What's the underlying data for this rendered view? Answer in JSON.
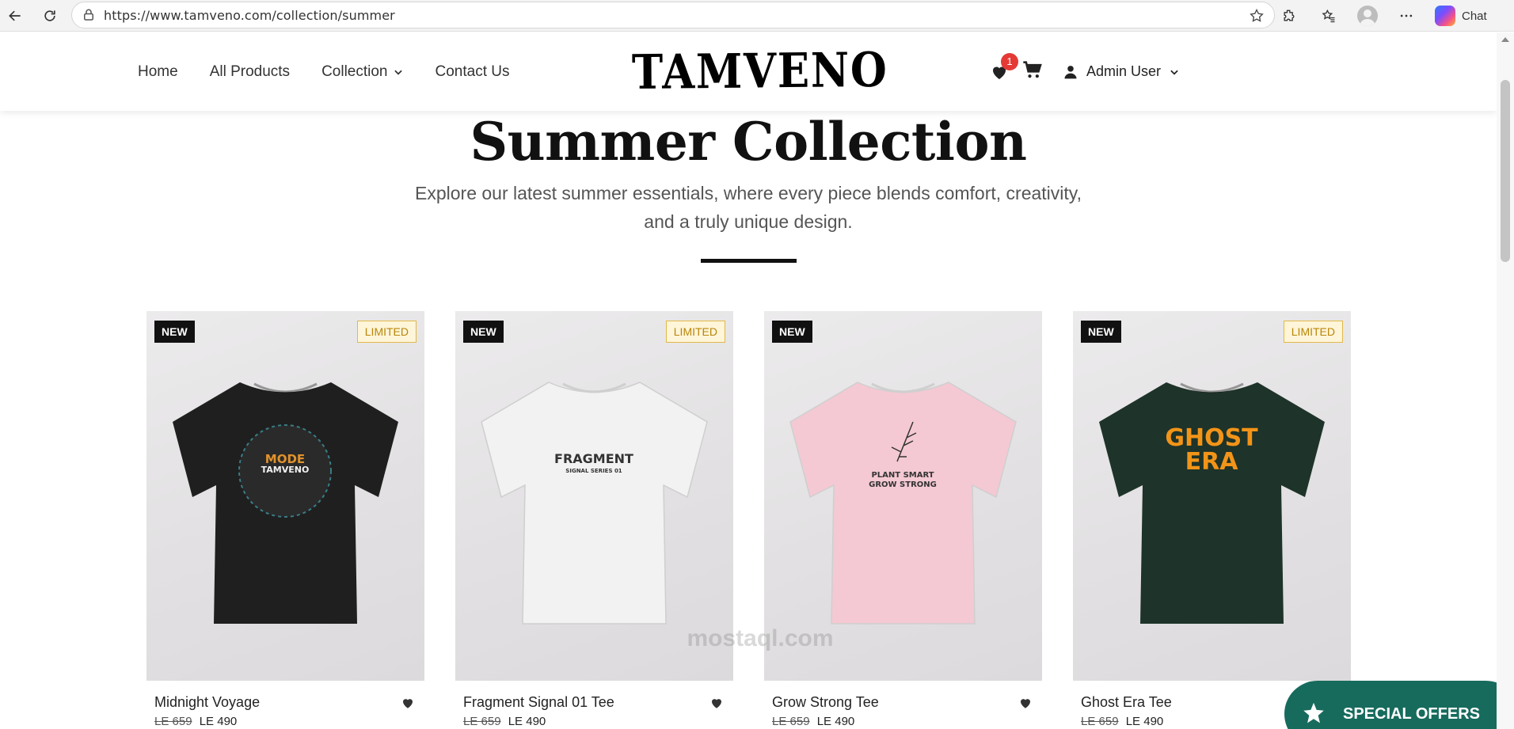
{
  "browser": {
    "url": "https://www.tamveno.com/collection/summer",
    "copilot_label": "Chat"
  },
  "nav": {
    "items": [
      {
        "label": "Home"
      },
      {
        "label": "All Products"
      },
      {
        "label": "Collection"
      },
      {
        "label": "Contact Us"
      }
    ]
  },
  "brand": {
    "name": "TAMVENO"
  },
  "header": {
    "wishlist_count": "1",
    "user_label": "Admin User"
  },
  "hero": {
    "title": "Summer Collection",
    "subtitle_line1": "Explore our latest summer essentials, where every piece blends comfort, creativity,",
    "subtitle_line2": "and a truly unique design."
  },
  "products": [
    {
      "name": "Midnight Voyage",
      "badge_new": "NEW",
      "badge_limited": "LIMITED",
      "old_price": "LE 659",
      "price": "LE 490",
      "shirt_color": "#1f1f1f",
      "print_line1": "MODE",
      "print_line2": "TAMVENO"
    },
    {
      "name": "Fragment Signal 01 Tee",
      "badge_new": "NEW",
      "badge_limited": "LIMITED",
      "old_price": "LE 659",
      "price": "LE 490",
      "shirt_color": "#f2f2f2",
      "print_line1": "FRAGMENT",
      "print_line2": "SIGNAL SERIES 01"
    },
    {
      "name": "Grow Strong Tee",
      "badge_new": "NEW",
      "badge_limited": "",
      "old_price": "LE 659",
      "price": "LE 490",
      "shirt_color": "#f4c9d3",
      "print_line1": "PLANT SMART",
      "print_line2": "GROW STRONG"
    },
    {
      "name": "Ghost Era Tee",
      "badge_new": "NEW",
      "badge_limited": "LIMITED",
      "old_price": "LE 659",
      "price": "LE 490",
      "shirt_color": "#1e3329",
      "print_line1": "GHOST",
      "print_line2": "ERA"
    }
  ],
  "watermark": {
    "text": "mostaql.com"
  },
  "special_offers": {
    "label": "SPECIAL OFFERS"
  },
  "colors": {
    "accent": "#176b5d",
    "badge_red": "#e53935",
    "limited_gold": "#b8860b"
  }
}
